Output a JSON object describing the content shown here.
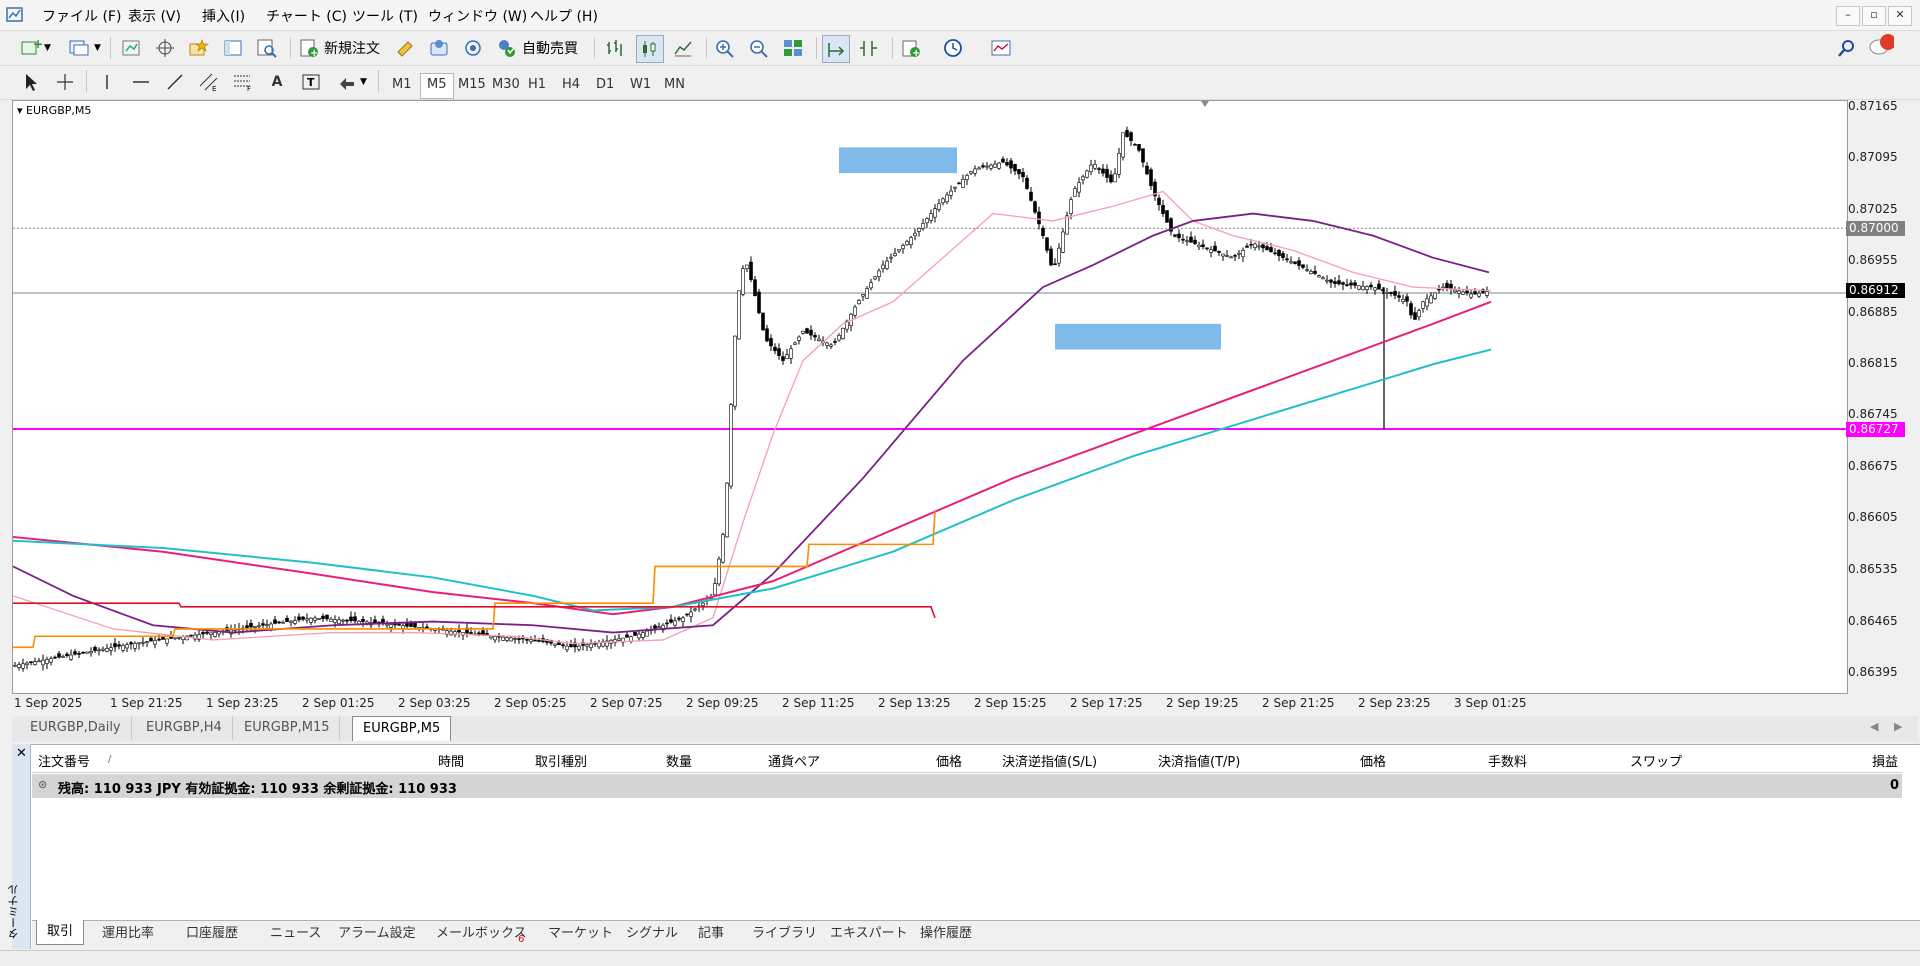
{
  "menu": [
    "ファイル (F)",
    "表示 (V)",
    "挿入(I)",
    "チャート (C)",
    "ツール (T)",
    "ウィンドウ (W)",
    "ヘルプ (H)"
  ],
  "toolbar": {
    "new_order": "新規注文",
    "auto_trade": "自動売買",
    "notification_count": "1"
  },
  "timeframes": [
    "M1",
    "M5",
    "M15",
    "M30",
    "H1",
    "H4",
    "D1",
    "W1",
    "MN"
  ],
  "active_timeframe": "M5",
  "chart": {
    "symbol_label": "EURGBP,M5",
    "price_axis": [
      "0.87165",
      "0.87095",
      "0.87025",
      "0.86955",
      "0.86885",
      "0.86815",
      "0.86745",
      "0.86675",
      "0.86605",
      "0.86535",
      "0.86465",
      "0.86395"
    ],
    "tags": {
      "ask_line": "0.87000",
      "bid": "0.86912",
      "hline": "0.86727"
    },
    "time_axis": [
      "1 Sep 2025",
      "1 Sep 21:25",
      "1 Sep 23:25",
      "2 Sep 01:25",
      "2 Sep 03:25",
      "2 Sep 05:25",
      "2 Sep 07:25",
      "2 Sep 09:25",
      "2 Sep 11:25",
      "2 Sep 13:25",
      "2 Sep 15:25",
      "2 Sep 17:25",
      "2 Sep 19:25",
      "2 Sep 21:25",
      "2 Sep 23:25",
      "3 Sep 01:25"
    ],
    "colors": {
      "candle": "#000000",
      "ma_fast": "#f4a0b0",
      "ma_purple": "#7a1f86",
      "ma_magenta": "#e8207a",
      "ma_cyan": "#20c0c8",
      "orange": "#ff8c00",
      "red": "#e0102a",
      "hline": "#ff00ff",
      "zone": "#6aaee8"
    }
  },
  "chart_tabs": [
    "EURGBP,Daily",
    "EURGBP,H4",
    "EURGBP,M15",
    "EURGBP,M5"
  ],
  "active_chart_tab": "EURGBP,M5",
  "terminal": {
    "side_label": "ターミナル",
    "columns": [
      "注文番号",
      "時間",
      "取引種別",
      "数量",
      "通貨ペア",
      "価格",
      "決済逆指値(S/L)",
      "決済指値(T/P)",
      "価格",
      "手数料",
      "スワップ",
      "損益"
    ],
    "balance_text": "残高: 110 933 JPY  有効証拠金: 110 933  余剰証拠金: 110 933",
    "profit": "0",
    "tabs": [
      "取引",
      "運用比率",
      "口座履歴",
      "ニュース",
      "アラーム設定",
      "メールボックス",
      "マーケット",
      "シグナル",
      "記事",
      "ライブラリ",
      "エキスパート",
      "操作履歴"
    ],
    "mailbox_count": "6",
    "active_tab": "取引"
  }
}
